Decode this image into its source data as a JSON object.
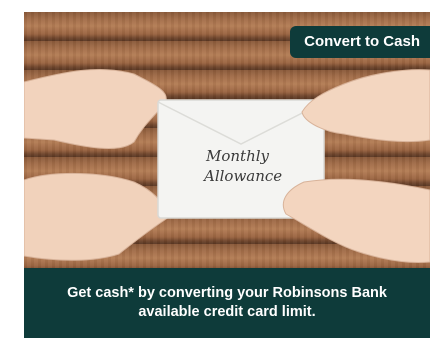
{
  "banner": {
    "cta_label": "Convert to Cash",
    "envelope_text_line1": "Monthly",
    "envelope_text_line2": "Allowance",
    "footer_line1": "Get cash* by converting your Robinsons Bank",
    "footer_line2": "available credit card limit.",
    "colors": {
      "accent": "#0e3b3a",
      "text": "#ffffff"
    }
  }
}
